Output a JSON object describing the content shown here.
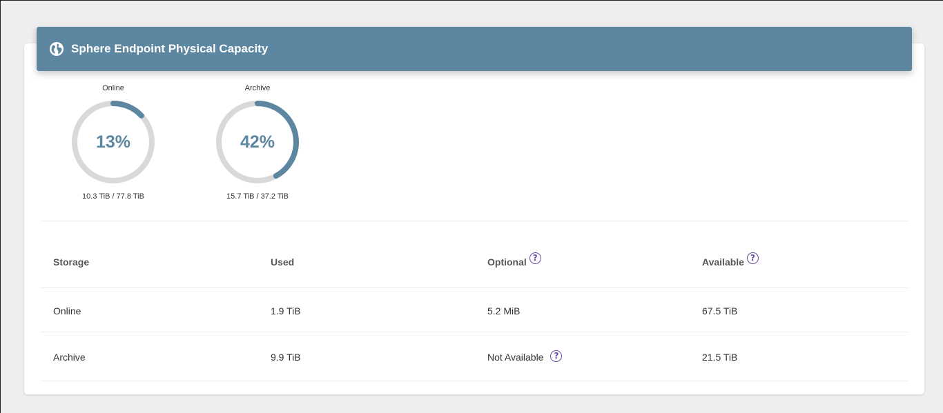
{
  "panel": {
    "title": "Sphere Endpoint Physical Capacity",
    "accent": "#5d87a1",
    "track_color": "#d9d9d9"
  },
  "gauges": [
    {
      "label": "Online",
      "percent_text": "13%",
      "percent": 13,
      "capacity": "10.3 TiB / 77.8 TiB"
    },
    {
      "label": "Archive",
      "percent_text": "42%",
      "percent": 42,
      "capacity": "15.7 TiB / 37.2 TiB"
    }
  ],
  "table": {
    "headers": [
      "Storage",
      "Used",
      "Optional",
      "Available"
    ],
    "rows": [
      [
        "Online",
        "1.9 TiB",
        "5.2 MiB",
        "67.5 TiB"
      ],
      [
        "Archive",
        "9.9 TiB",
        "Not Available",
        "21.5 TiB"
      ]
    ],
    "help_glyph": "?"
  }
}
